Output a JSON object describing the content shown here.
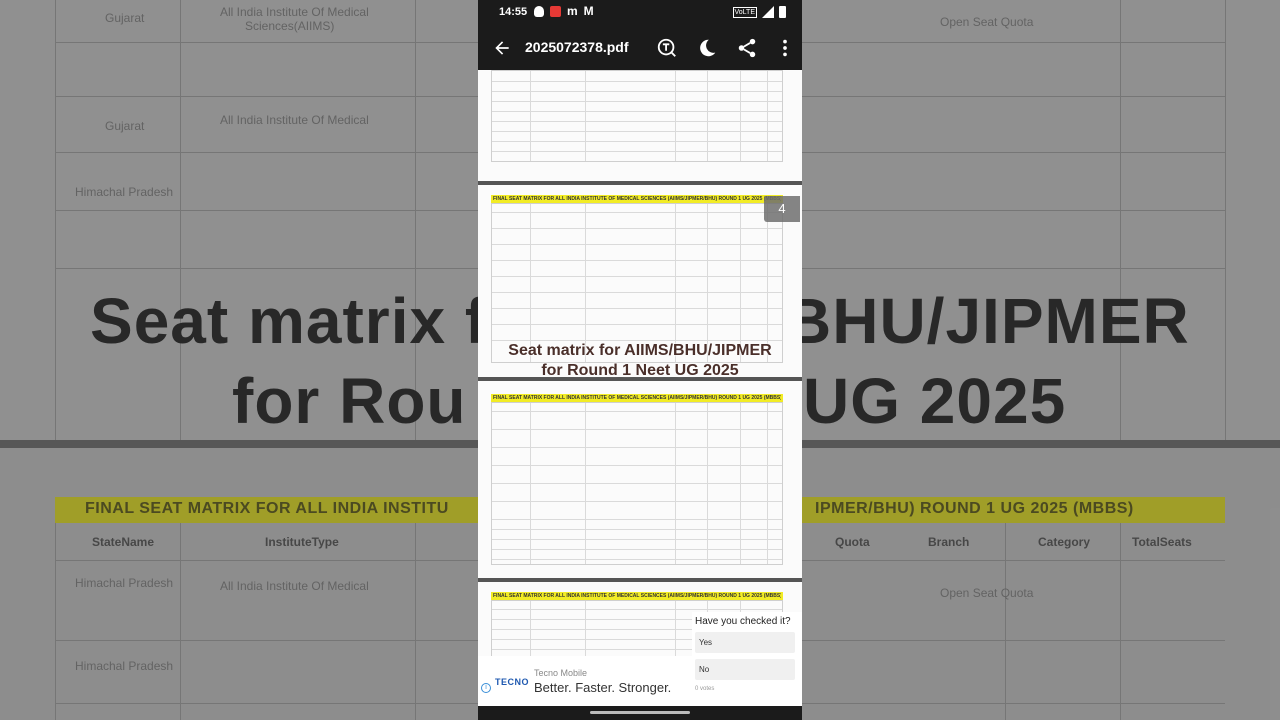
{
  "status_bar": {
    "time": "14:55"
  },
  "app_bar": {
    "file_name": "2025072378.pdf"
  },
  "viewer": {
    "page_indicator": "4",
    "page_header_text": "FINAL SEAT MATRIX FOR ALL INDIA INSTITUTE OF MEDICAL SCIENCES (AIIMS/JIPMER/BHU) ROUND 1 UG 2025 (MBBS)"
  },
  "caption": {
    "line1": "Seat matrix for AIIMS/BHU/JIPMER",
    "line2": "for Round 1 Neet UG 2025"
  },
  "background_text": {
    "big_left_1": "Seat matrix f",
    "big_right_1": "BHU/JIPMER",
    "big_left_2": "for Rou",
    "big_right_2": "UG 2025",
    "banner_left": "FINAL SEAT MATRIX FOR ALL INDIA INSTITU",
    "banner_right": "IPMER/BHU) ROUND 1 UG 2025 (MBBS)",
    "col_state": "StateName",
    "col_type": "InstituteType",
    "col_quota": "Quota",
    "col_branch": "Branch",
    "col_category": "Category",
    "col_seats": "TotalSeats",
    "cell_gujarat": "Gujarat",
    "cell_aiims": "All India Institute Of Medical",
    "cell_sciences": "Sciences(AIIMS)",
    "cell_hp": "Himachal Pradesh",
    "cell_open": "Open Seat Quota"
  },
  "ad": {
    "logo": "TECNO",
    "brand": "Tecno Mobile",
    "slogan": "Better. Faster. Stronger."
  },
  "poll": {
    "question": "Have you checked it?",
    "options": [
      "Yes",
      "No"
    ],
    "votes": "0 votes"
  }
}
